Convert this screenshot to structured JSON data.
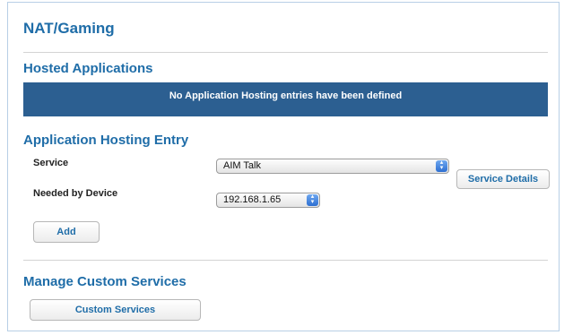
{
  "page": {
    "title": "NAT/Gaming"
  },
  "hosted_applications": {
    "title": "Hosted Applications",
    "empty_message": "No Application Hosting entries have been defined"
  },
  "entry": {
    "title": "Application Hosting Entry",
    "service_label": "Service",
    "service_value": "AIM Talk",
    "service_details_button": "Service Details",
    "device_label": "Needed by Device",
    "device_value": "192.168.1.65",
    "add_button": "Add"
  },
  "custom": {
    "title": "Manage Custom Services",
    "button": "Custom Services"
  },
  "colors": {
    "heading": "#1f6da8",
    "banner": "#2c5f91",
    "frame_border": "#b8cfe6"
  }
}
